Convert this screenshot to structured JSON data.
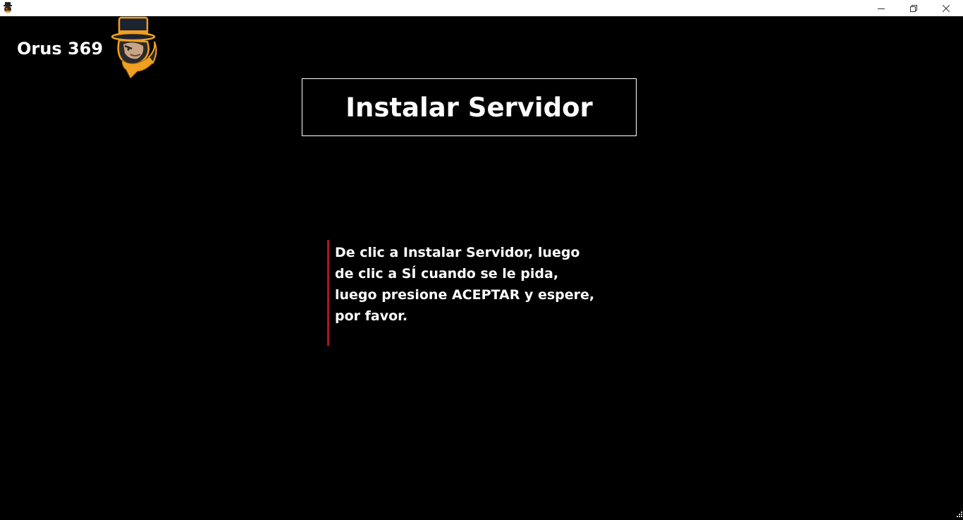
{
  "window": {
    "app_icon": "orus-mascot-icon",
    "controls": {
      "minimize_icon": "minimize-icon",
      "maximize_icon": "restore-icon",
      "close_icon": "close-icon"
    }
  },
  "header": {
    "brand_name": "Orus 369",
    "logo": "gorilla-top-hat-mascot-logo"
  },
  "main": {
    "install_button_label": "Instalar Servidor",
    "notice_text": "De clic a Instalar Servidor, luego de clic a SÍ cuando se le pida, luego presione ACEPTAR y espere, por favor."
  },
  "colors": {
    "background": "#000000",
    "titlebar": "#ffffff",
    "text": "#ffffff",
    "accent_bar": "#b01818",
    "logo_accent": "#f0a020"
  }
}
